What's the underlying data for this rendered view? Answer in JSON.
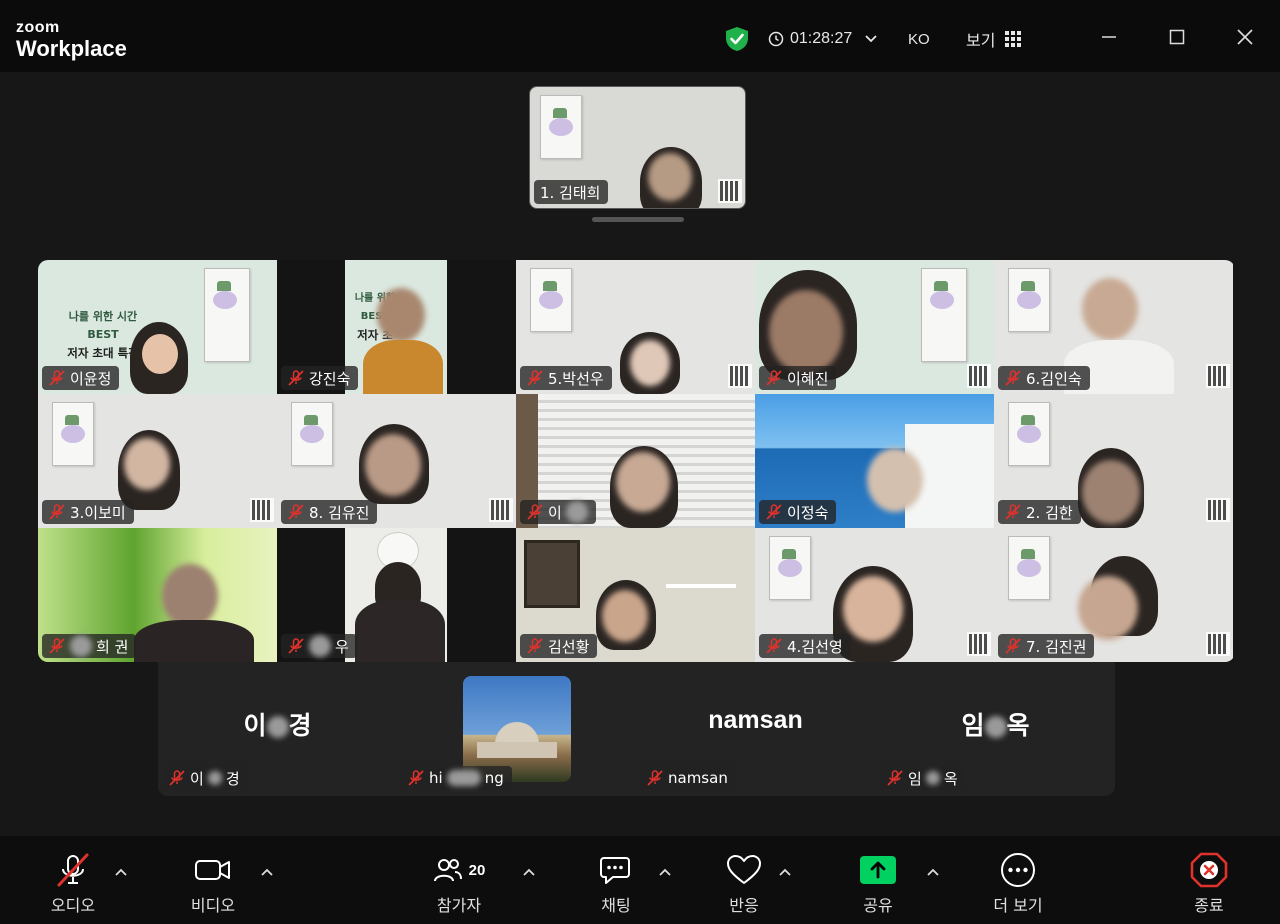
{
  "app": {
    "brand_line1": "zoom",
    "brand_line2": "Workplace"
  },
  "titlebar": {
    "timer": "01:28:27",
    "language": "KO",
    "view_label": "보기"
  },
  "spotlight": {
    "name": "1. 김태희"
  },
  "gallery": [
    {
      "name": "이윤정",
      "promo": [
        "나를 위한 시간",
        "BEST",
        "저자 초대 특강"
      ]
    },
    {
      "name": "강진숙",
      "promo": [
        "나를 위한",
        "BEST",
        "저자 초"
      ]
    },
    {
      "name": "5.박선우"
    },
    {
      "name": "이혜진"
    },
    {
      "name": "6.김인숙"
    },
    {
      "name": "3.이보미"
    },
    {
      "name": "8. 김유진"
    },
    {
      "name": "이"
    },
    {
      "name": "이정숙"
    },
    {
      "name": "2. 김한"
    },
    {
      "name": "희 권"
    },
    {
      "name": "우"
    },
    {
      "name": "김선황"
    },
    {
      "name": "4.김선영"
    },
    {
      "name": "7. 김진권"
    }
  ],
  "audio_only": [
    {
      "display": [
        "이",
        "경"
      ],
      "label": [
        "이",
        "경"
      ]
    },
    {
      "display": [],
      "label": [
        "hi",
        "ng"
      ]
    },
    {
      "display": [
        "namsan"
      ],
      "label": [
        "namsan"
      ]
    },
    {
      "display": [
        "임",
        "옥"
      ],
      "label": [
        "임",
        "옥"
      ]
    }
  ],
  "toolbar": {
    "audio": "오디오",
    "video": "비디오",
    "participants": "참가자",
    "participants_count": "20",
    "chat": "채팅",
    "reactions": "반응",
    "share": "공유",
    "more": "더 보기",
    "end": "종료"
  },
  "colors": {
    "shield": "#21b14b",
    "share": "#00d160",
    "end": "#e0322c",
    "mute": "#e0322c"
  }
}
